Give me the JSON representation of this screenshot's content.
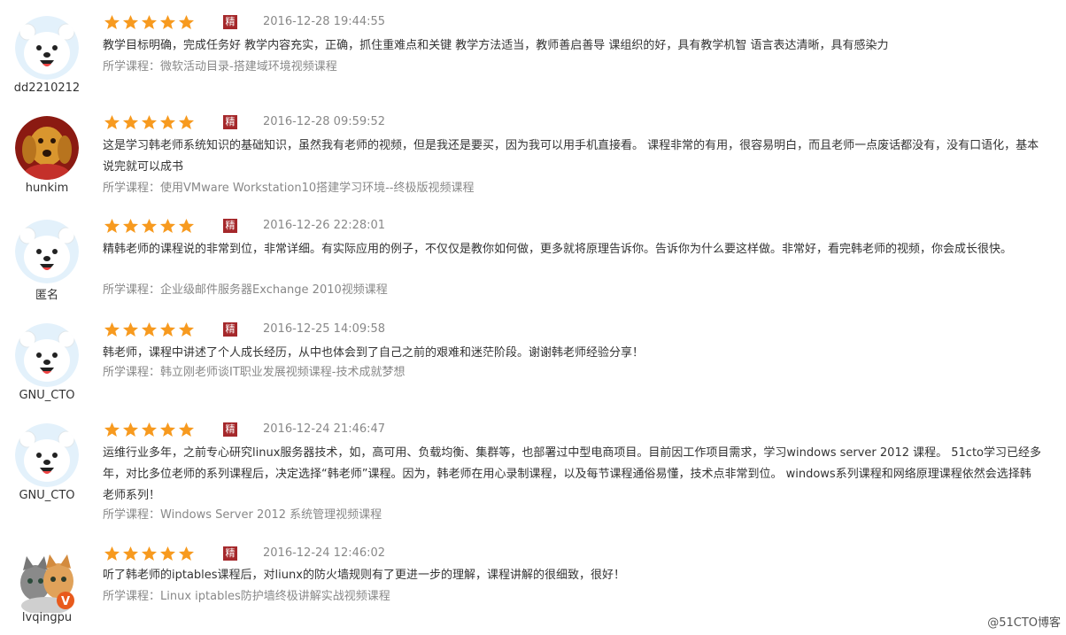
{
  "reviews": [
    {
      "user": "dd2210212",
      "avatar": "bear-avatar",
      "rating": 5,
      "badge": "精",
      "time": "2016-12-28 19:44:55",
      "content": "教学目标明确，完成任务好 教学内容充实，正确，抓住重难点和关键 教学方法适当，教师善启善导 课组织的好，具有教学机智 语言表达清晰，具有感染力",
      "course_label": "所学课程：",
      "course": "微软活动目录-搭建域环境视频课程"
    },
    {
      "user": "hunkim",
      "avatar": "golden-dog-avatar",
      "rating": 5,
      "badge": "精",
      "time": "2016-12-28 09:59:52",
      "content": "这是学习韩老师系统知识的基础知识，虽然我有老师的视频，但是我还是要买，因为我可以用手机直接看。 课程非常的有用，很容易明白，而且老师一点废话都没有，没有口语化，基本说完就可以成书",
      "course_label": "所学课程：",
      "course": "使用VMware Workstation10搭建学习环境--终极版视频课程"
    },
    {
      "user": "匿名",
      "avatar": "bear-avatar",
      "rating": 5,
      "badge": "精",
      "time": "2016-12-26 22:28:01",
      "content": "精韩老师的课程说的非常到位，非常详细。有实际应用的例子，不仅仅是教你如何做，更多就将原理告诉你。告诉你为什么要这样做。非常好，看完韩老师的视频，你会成长很快。",
      "course_label": "所学课程：",
      "course": "企业级邮件服务器Exchange 2010视频课程"
    },
    {
      "user": "GNU_CTO",
      "avatar": "bear-avatar",
      "rating": 5,
      "badge": "精",
      "time": "2016-12-25 14:09:58",
      "content": "韩老师，课程中讲述了个人成长经历，从中也体会到了自己之前的艰难和迷茫阶段。谢谢韩老师经验分享！",
      "course_label": "所学课程：",
      "course": "韩立刚老师谈IT职业发展视频课程-技术成就梦想"
    },
    {
      "user": "GNU_CTO",
      "avatar": "bear-avatar",
      "rating": 5,
      "badge": "精",
      "time": "2016-12-24 21:46:47",
      "content": "运维行业多年，之前专心研究linux服务器技术，如，高可用、负载均衡、集群等，也部署过中型电商项目。目前因工作项目需求，学习windows server 2012 课程。 51cto学习已经多年，对比多位老师的系列课程后，决定选择“韩老师”课程。因为，韩老师在用心录制课程，以及每节课程通俗易懂，技术点非常到位。 windows系列课程和网络原理课程依然会选择韩老师系列！",
      "course_label": "所学课程：",
      "course": "Windows Server 2012 系统管理视频课程"
    },
    {
      "user": "lvqingpu",
      "avatar": "kittens-avatar",
      "rating": 5,
      "badge": "精",
      "time": "2016-12-24 12:46:02",
      "content": "听了韩老师的iptables课程后，对liunx的防火墙规则有了更进一步的理解，课程讲解的很细致，很好！",
      "course_label": "所学课程：",
      "course": "Linux iptables防护墙终极讲解实战视频课程"
    }
  ],
  "colors": {
    "star": "#f79a1f",
    "badge": "#a5282b",
    "meta": "#888888"
  },
  "watermark": "@51CTO博客"
}
